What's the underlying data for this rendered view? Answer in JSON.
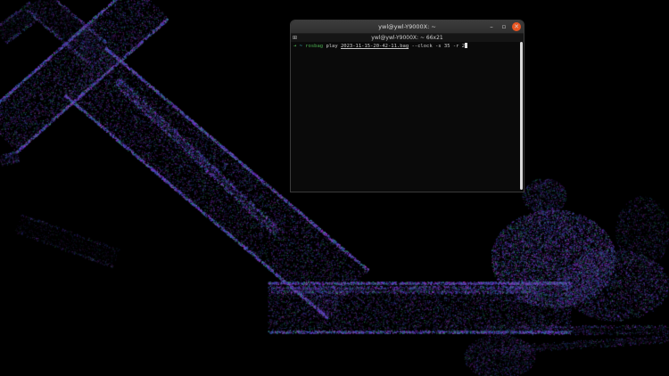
{
  "colors": {
    "desktop_bg": "#000000",
    "pointcloud_purple": "#8a2be2",
    "pointcloud_magenta": "#b03cc8",
    "pointcloud_blue": "#3a4fd0",
    "pointcloud_green": "#2fa86a",
    "close_button": "#e95420",
    "prompt_green": "#4caf50",
    "prompt_cyan": "#3fb6c6"
  },
  "terminal": {
    "window_title": "ywl@ywl-Y9000X: ~",
    "subtitle": "ywl@ywl-Y9000X: ~ 66x21",
    "tab_icon": "new-tab-icon",
    "buttons": {
      "minimize": "–",
      "maximize": "▫",
      "close": "✕"
    },
    "prompt": {
      "arrow": "➜",
      "dir": "~",
      "command": "rosbag",
      "subcommand": "play",
      "file": "2023-11-15-20-42-11.bag",
      "options": "--clock -s 35 -r 2"
    }
  }
}
